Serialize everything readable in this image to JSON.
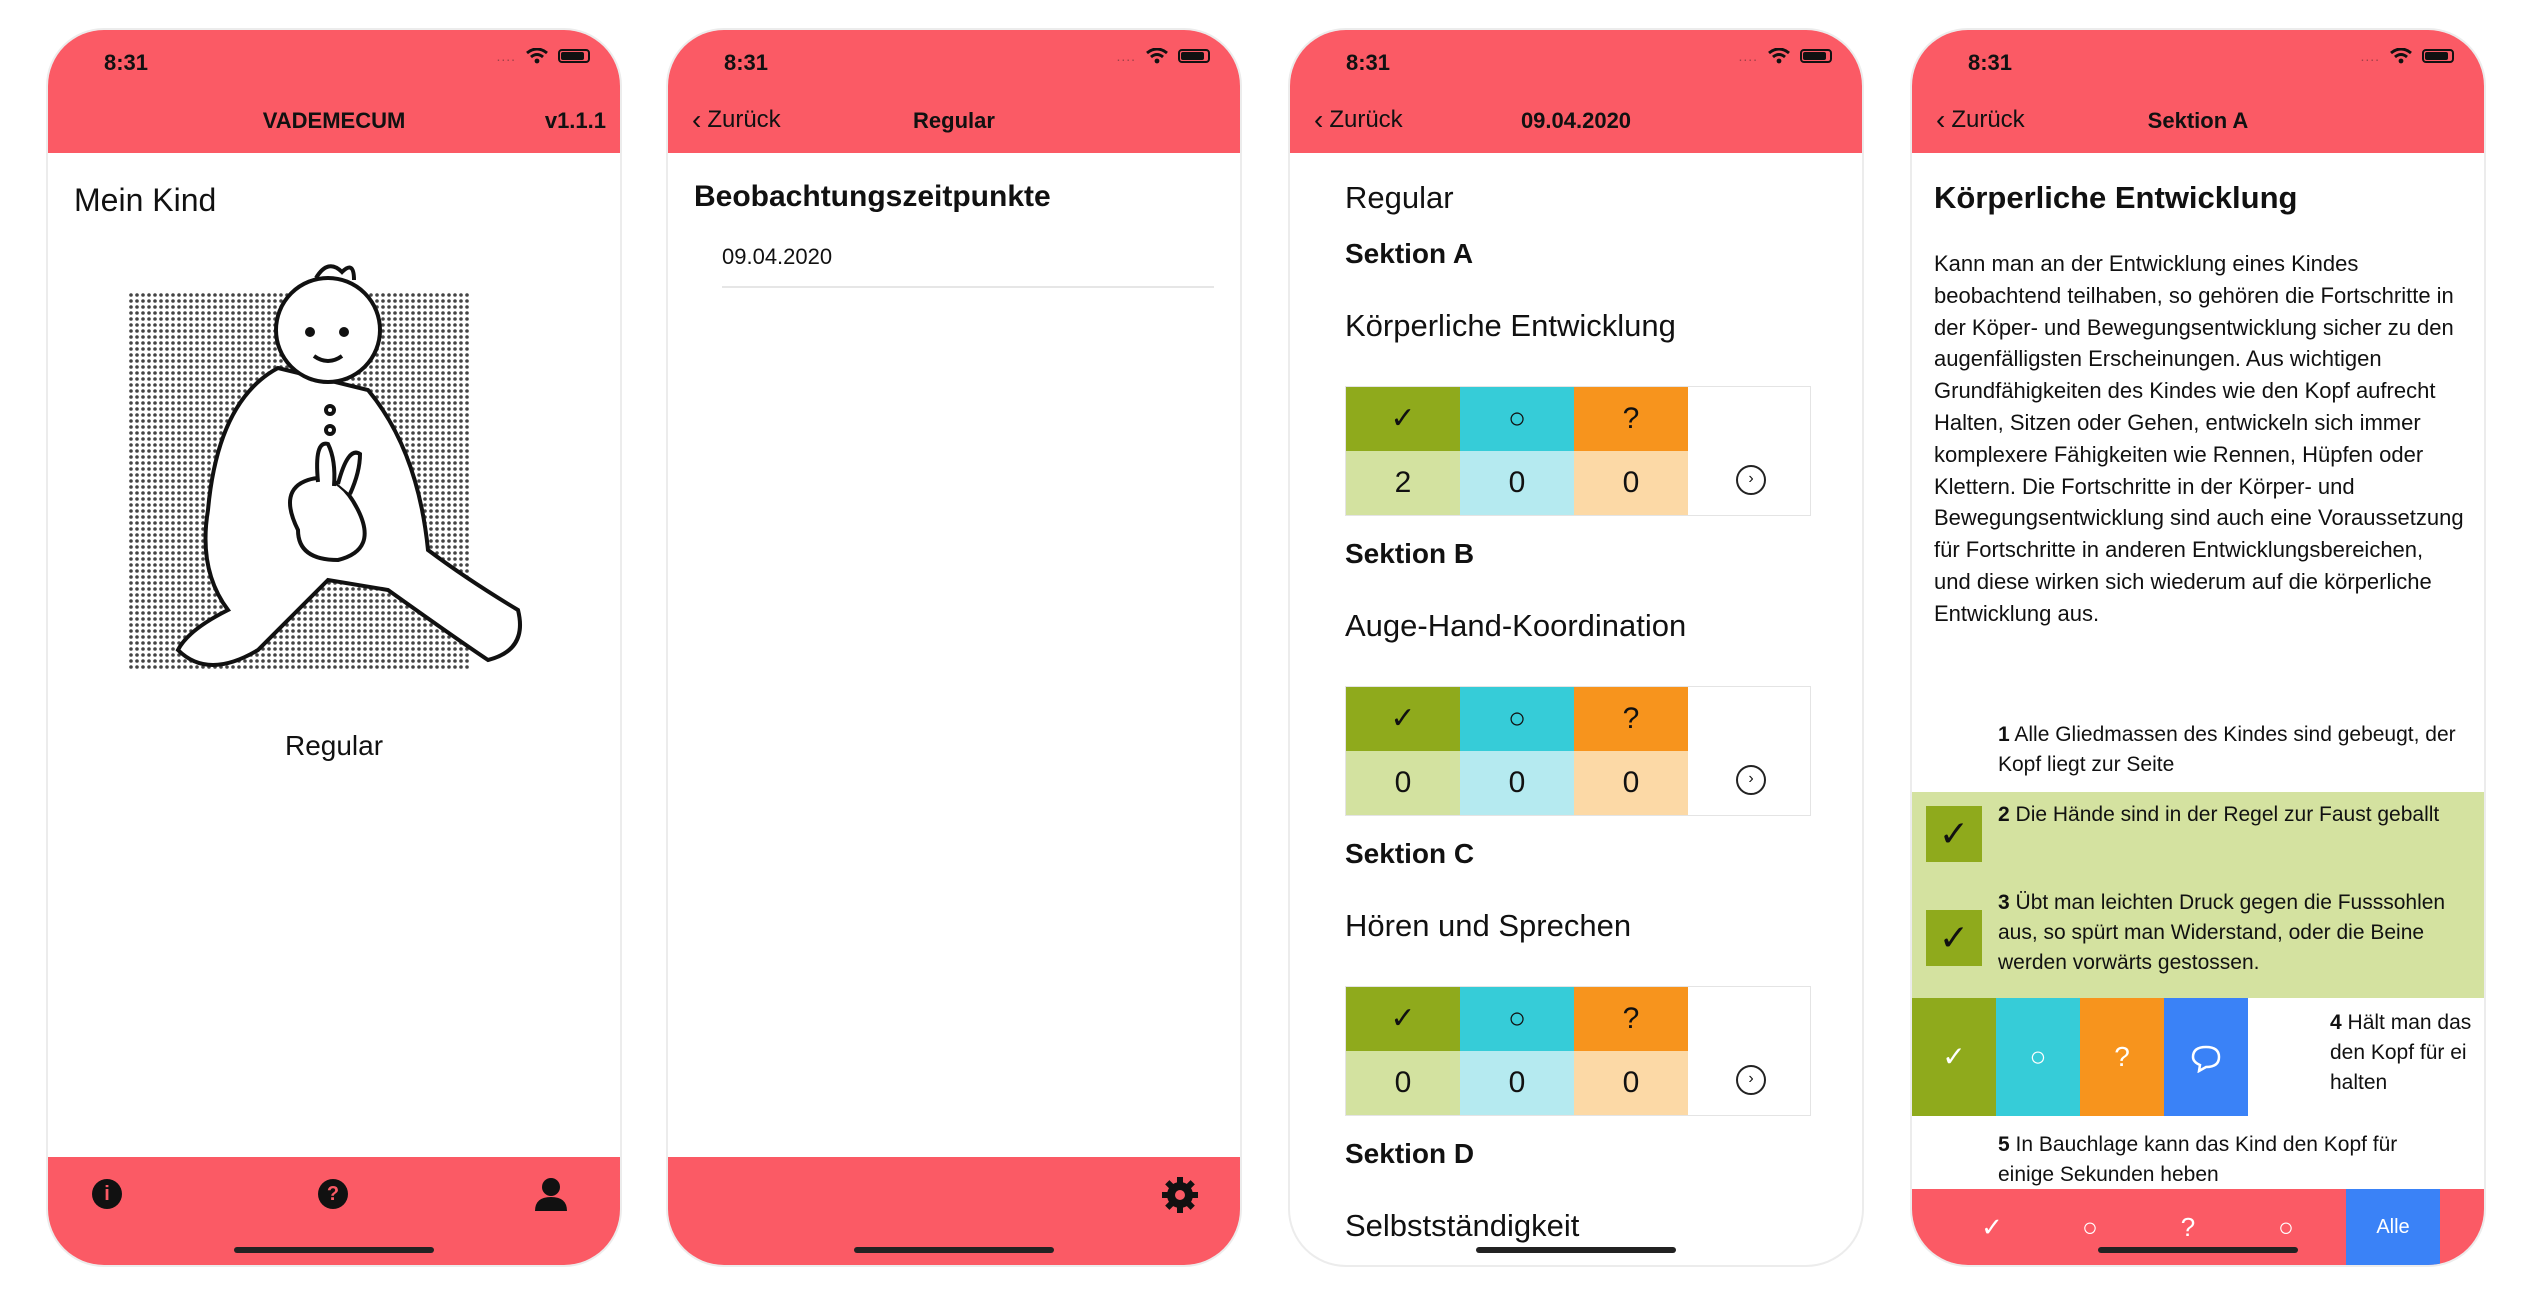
{
  "status": {
    "time": "8:31",
    "signal": "....",
    "wifi_icon": "wifi-icon",
    "battery_icon": "battery-icon"
  },
  "colors": {
    "header": "#fb5a65",
    "green": "#8faa1c",
    "green_light": "#d3e2a0",
    "cyan": "#36ccd8",
    "cyan_light": "#b5eaf0",
    "orange": "#f7941d",
    "orange_light": "#fcd9a6",
    "blue": "#3a82f7"
  },
  "screen1": {
    "app_title": "VADEMECUM",
    "version": "v1.1.1",
    "heading": "Mein Kind",
    "caption": "Regular",
    "tab_icons": [
      "info-icon",
      "question-icon",
      "person-icon"
    ]
  },
  "screen2": {
    "back_label": "Zurück",
    "title": "Regular",
    "heading": "Beobachtungszeitpunkte",
    "list_items": [
      "09.04.2020"
    ],
    "tab_icon": "gear-icon"
  },
  "screen3": {
    "back_label": "Zurück",
    "title": "09.04.2020",
    "group_title": "Regular",
    "symbols": {
      "yes": "✓",
      "no": "○",
      "unsure": "?",
      "open": "›"
    },
    "sections": [
      {
        "label": "Sektion A",
        "category": "Körperliche Entwicklung",
        "counts": [
          "2",
          "0",
          "0"
        ]
      },
      {
        "label": "Sektion B",
        "category": "Auge-Hand-Koordination",
        "counts": [
          "0",
          "0",
          "0"
        ]
      },
      {
        "label": "Sektion C",
        "category": "Hören und Sprechen",
        "counts": [
          "0",
          "0",
          "0"
        ]
      },
      {
        "label": "Sektion D",
        "category": "Selbstständigkeit"
      }
    ]
  },
  "screen4": {
    "back_label": "Zurück",
    "title": "Sektion A",
    "heading": "Körperliche Entwicklung",
    "paragraph": "Kann man an der Entwicklung eines Kindes beobachtend teilhaben, so gehören die Fortschritte in der Köper- und Bewegungsentwicklung sicher zu den augenfälligsten Erscheinungen. Aus wichtigen Grundfähigkeiten des Kindes wie den Kopf aufrecht Halten, Sitzen oder Gehen, entwickeln sich immer komplexere Fähigkeiten wie Rennen, Hüpfen oder Klettern. Die Fortschritte in der Körper- und Bewegungsentwicklung sind auch eine Voraussetzung für Fortschritte in anderen Entwicklungsbereichen, und diese wirken sich wiederum auf die körperliche Entwicklung aus.",
    "items": [
      {
        "num": "1",
        "text": "Alle Gliedmassen des Kindes sind gebeugt, der Kopf liegt zur Seite"
      },
      {
        "num": "2",
        "text": "Die Hände sind in der Regel zur Faust geballt"
      },
      {
        "num": "3",
        "text": "Übt man leichten Druck gegen die Fusssohlen aus, so spürt man Widerstand, oder die Beine werden vorwärts gestossen."
      },
      {
        "num": "4",
        "text": "Hält man das den Kopf für ei halten"
      },
      {
        "num": "5",
        "text": "In Bauchlage kann das Kind den Kopf für einige Sekunden heben"
      }
    ],
    "rate_buttons": [
      "✓",
      "○",
      "?",
      "💬"
    ],
    "filter_tabs": [
      "✓",
      "○",
      "?",
      "○",
      "Alle"
    ]
  }
}
